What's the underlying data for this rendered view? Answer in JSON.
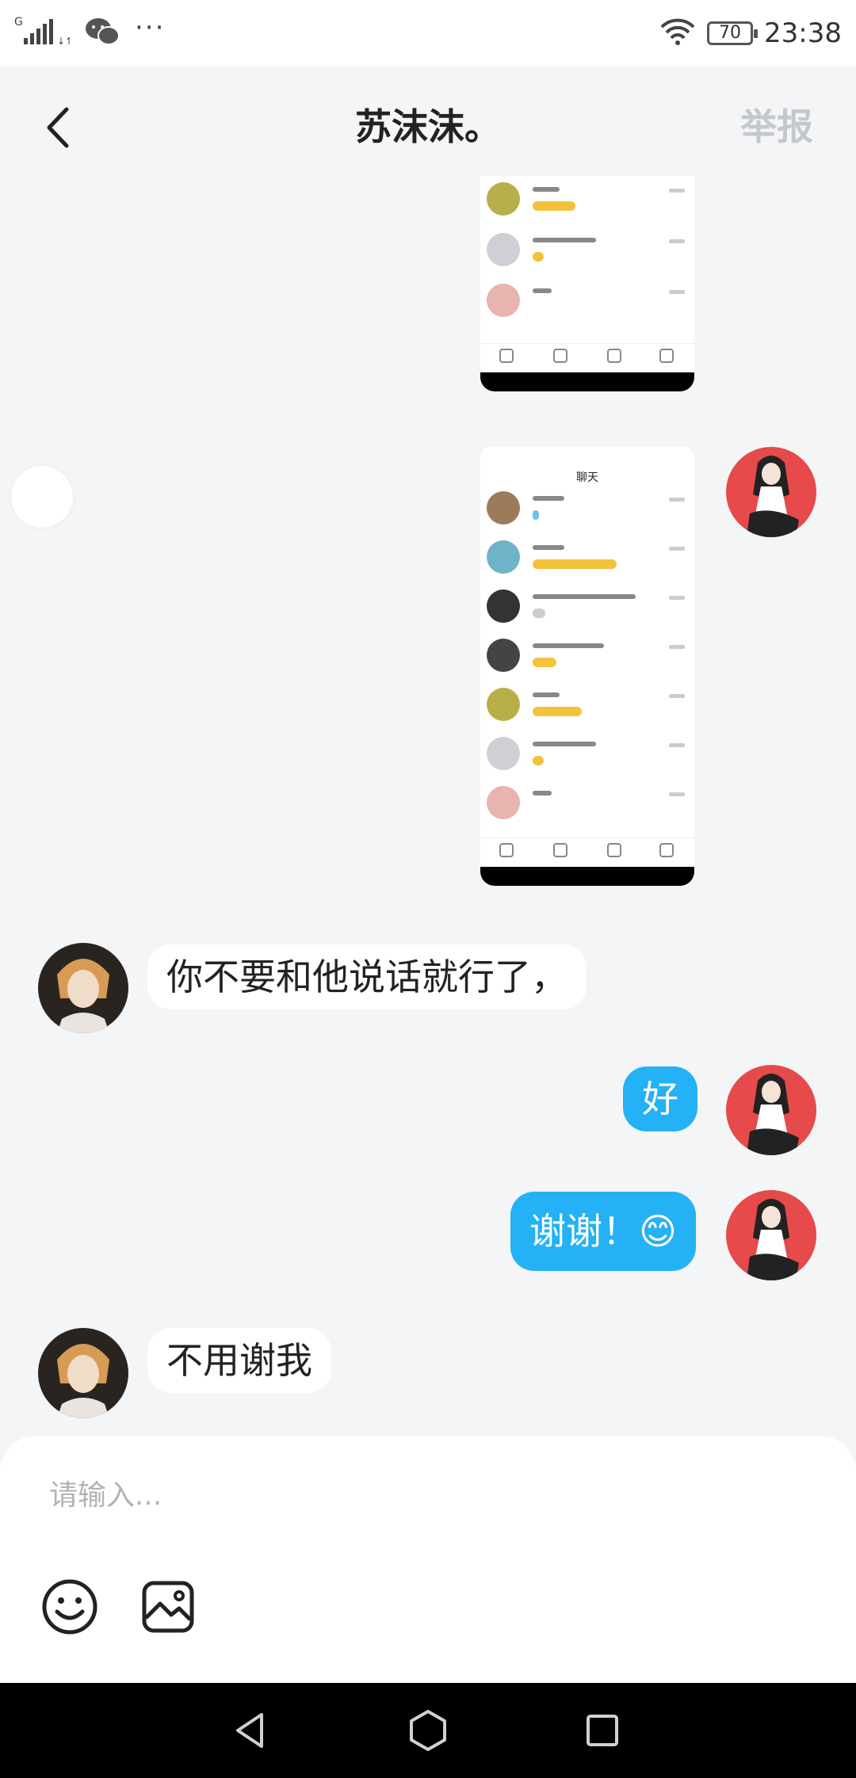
{
  "status_bar": {
    "network": "G",
    "battery": "70",
    "time": "23:38",
    "dots": "···"
  },
  "header": {
    "title": "苏沫沫。",
    "report_label": "举报"
  },
  "messages": [
    {
      "side": "in",
      "text": "你不要和他说话就行了，"
    },
    {
      "side": "out",
      "text": "好"
    },
    {
      "side": "out",
      "text": "谢谢！😊"
    },
    {
      "side": "in",
      "text": "不用谢我"
    }
  ],
  "screenshot_thumbnail_2": {
    "title": "聊天"
  },
  "input": {
    "placeholder": "请输入..."
  },
  "icons": {
    "back": "chevron-left-icon",
    "emoji": "smiley-icon",
    "image": "image-icon",
    "nav_back": "triangle-back-icon",
    "nav_home": "hexagon-home-icon",
    "nav_recent": "square-recent-icon"
  },
  "colors": {
    "outgoing_bubble": "#24b1f5",
    "incoming_bubble": "#ffffff",
    "background": "#f4f5f7",
    "report_text": "#c4c7cc"
  }
}
